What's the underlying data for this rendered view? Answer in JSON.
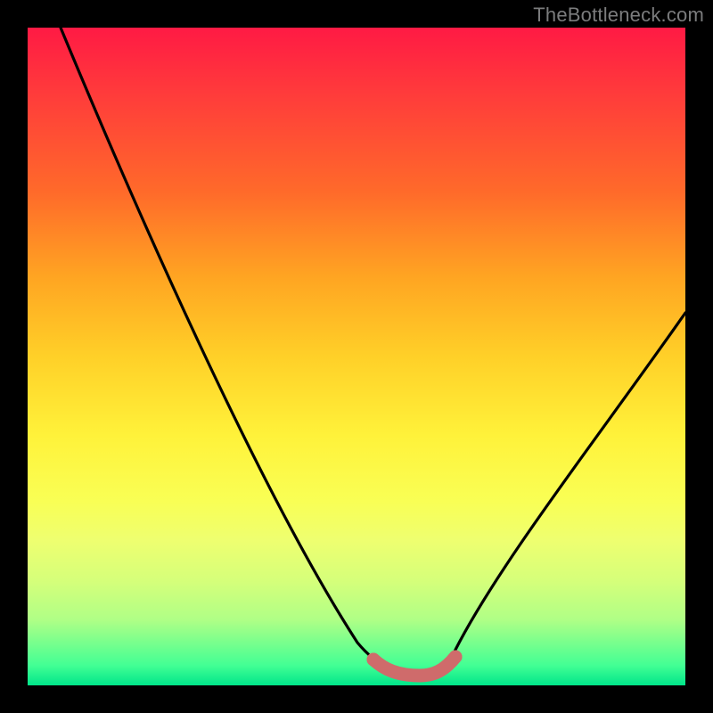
{
  "attribution": "TheBottleneck.com",
  "colors": {
    "frame": "#000000",
    "gradient_top": "#ff1a44",
    "gradient_mid": "#fff23a",
    "gradient_bottom": "#00e58a",
    "curve": "#000000",
    "valley_highlight": "#d46a6a"
  },
  "chart_data": {
    "type": "line",
    "title": "",
    "xlabel": "",
    "ylabel": "",
    "xlim": [
      0,
      100
    ],
    "ylim": [
      0,
      100
    ],
    "x": [
      5,
      10,
      15,
      20,
      25,
      30,
      35,
      40,
      45,
      50,
      52,
      55,
      58,
      60,
      63,
      65,
      70,
      75,
      80,
      85,
      90,
      95,
      100
    ],
    "values": [
      100,
      88,
      77,
      66,
      55,
      44,
      33,
      25,
      17,
      9,
      5,
      2,
      1,
      1,
      1,
      2,
      7,
      14,
      23,
      33,
      44,
      52,
      57
    ],
    "valley_region_x": [
      52,
      65
    ],
    "annotations": []
  }
}
